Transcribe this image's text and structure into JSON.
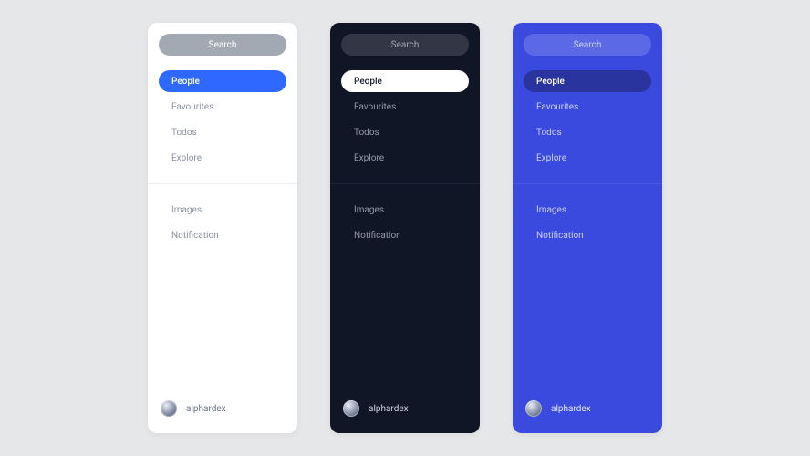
{
  "search": {
    "placeholder": "Search"
  },
  "section1": {
    "items": [
      {
        "label": "People",
        "active": true
      },
      {
        "label": "Favourites",
        "active": false
      },
      {
        "label": "Todos",
        "active": false
      },
      {
        "label": "Explore",
        "active": false
      }
    ]
  },
  "section2": {
    "items": [
      {
        "label": "Images",
        "active": false
      },
      {
        "label": "Notification",
        "active": false
      }
    ]
  },
  "user": {
    "name": "alphardex"
  },
  "themes": [
    "light",
    "dark",
    "blue"
  ]
}
